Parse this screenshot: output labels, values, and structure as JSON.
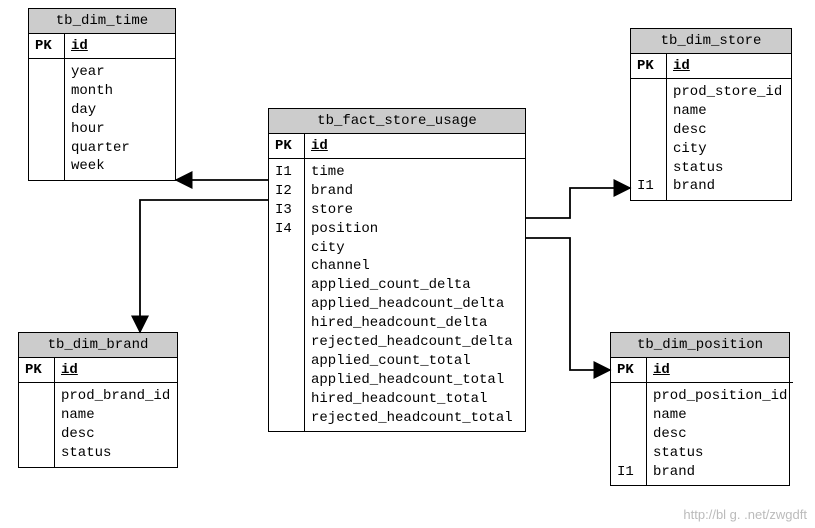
{
  "tables": {
    "time": {
      "title": "tb_dim_time",
      "pk_label": "PK",
      "pk_field": "id",
      "cols": [
        "year",
        "month",
        "day",
        "hour",
        "quarter",
        "week"
      ]
    },
    "brand": {
      "title": "tb_dim_brand",
      "pk_label": "PK",
      "pk_field": "id",
      "cols": [
        "prod_brand_id",
        "name",
        "desc",
        "status"
      ]
    },
    "fact": {
      "title": "tb_fact_store_usage",
      "pk_label": "PK",
      "pk_field": "id",
      "idx": [
        "I1",
        "I2",
        "I3",
        "I4"
      ],
      "cols": [
        "time",
        "brand",
        "store",
        "position",
        "city",
        "channel",
        "applied_count_delta",
        "applied_headcount_delta",
        "hired_headcount_delta",
        "rejected_headcount_delta",
        "applied_count_total",
        "applied_headcount_total",
        "hired_headcount_total",
        "rejected_headcount_total"
      ]
    },
    "store": {
      "title": "tb_dim_store",
      "pk_label": "PK",
      "pk_field": "id",
      "idx_label": "I1",
      "cols": [
        "prod_store_id",
        "name",
        "desc",
        "city",
        "status",
        "brand"
      ]
    },
    "position": {
      "title": "tb_dim_position",
      "pk_label": "PK",
      "pk_field": "id",
      "idx_label": "I1",
      "cols": [
        "prod_position_id",
        "name",
        "desc",
        "status",
        "brand"
      ]
    }
  },
  "watermark": "http://bl g.  .net/zwgdft"
}
